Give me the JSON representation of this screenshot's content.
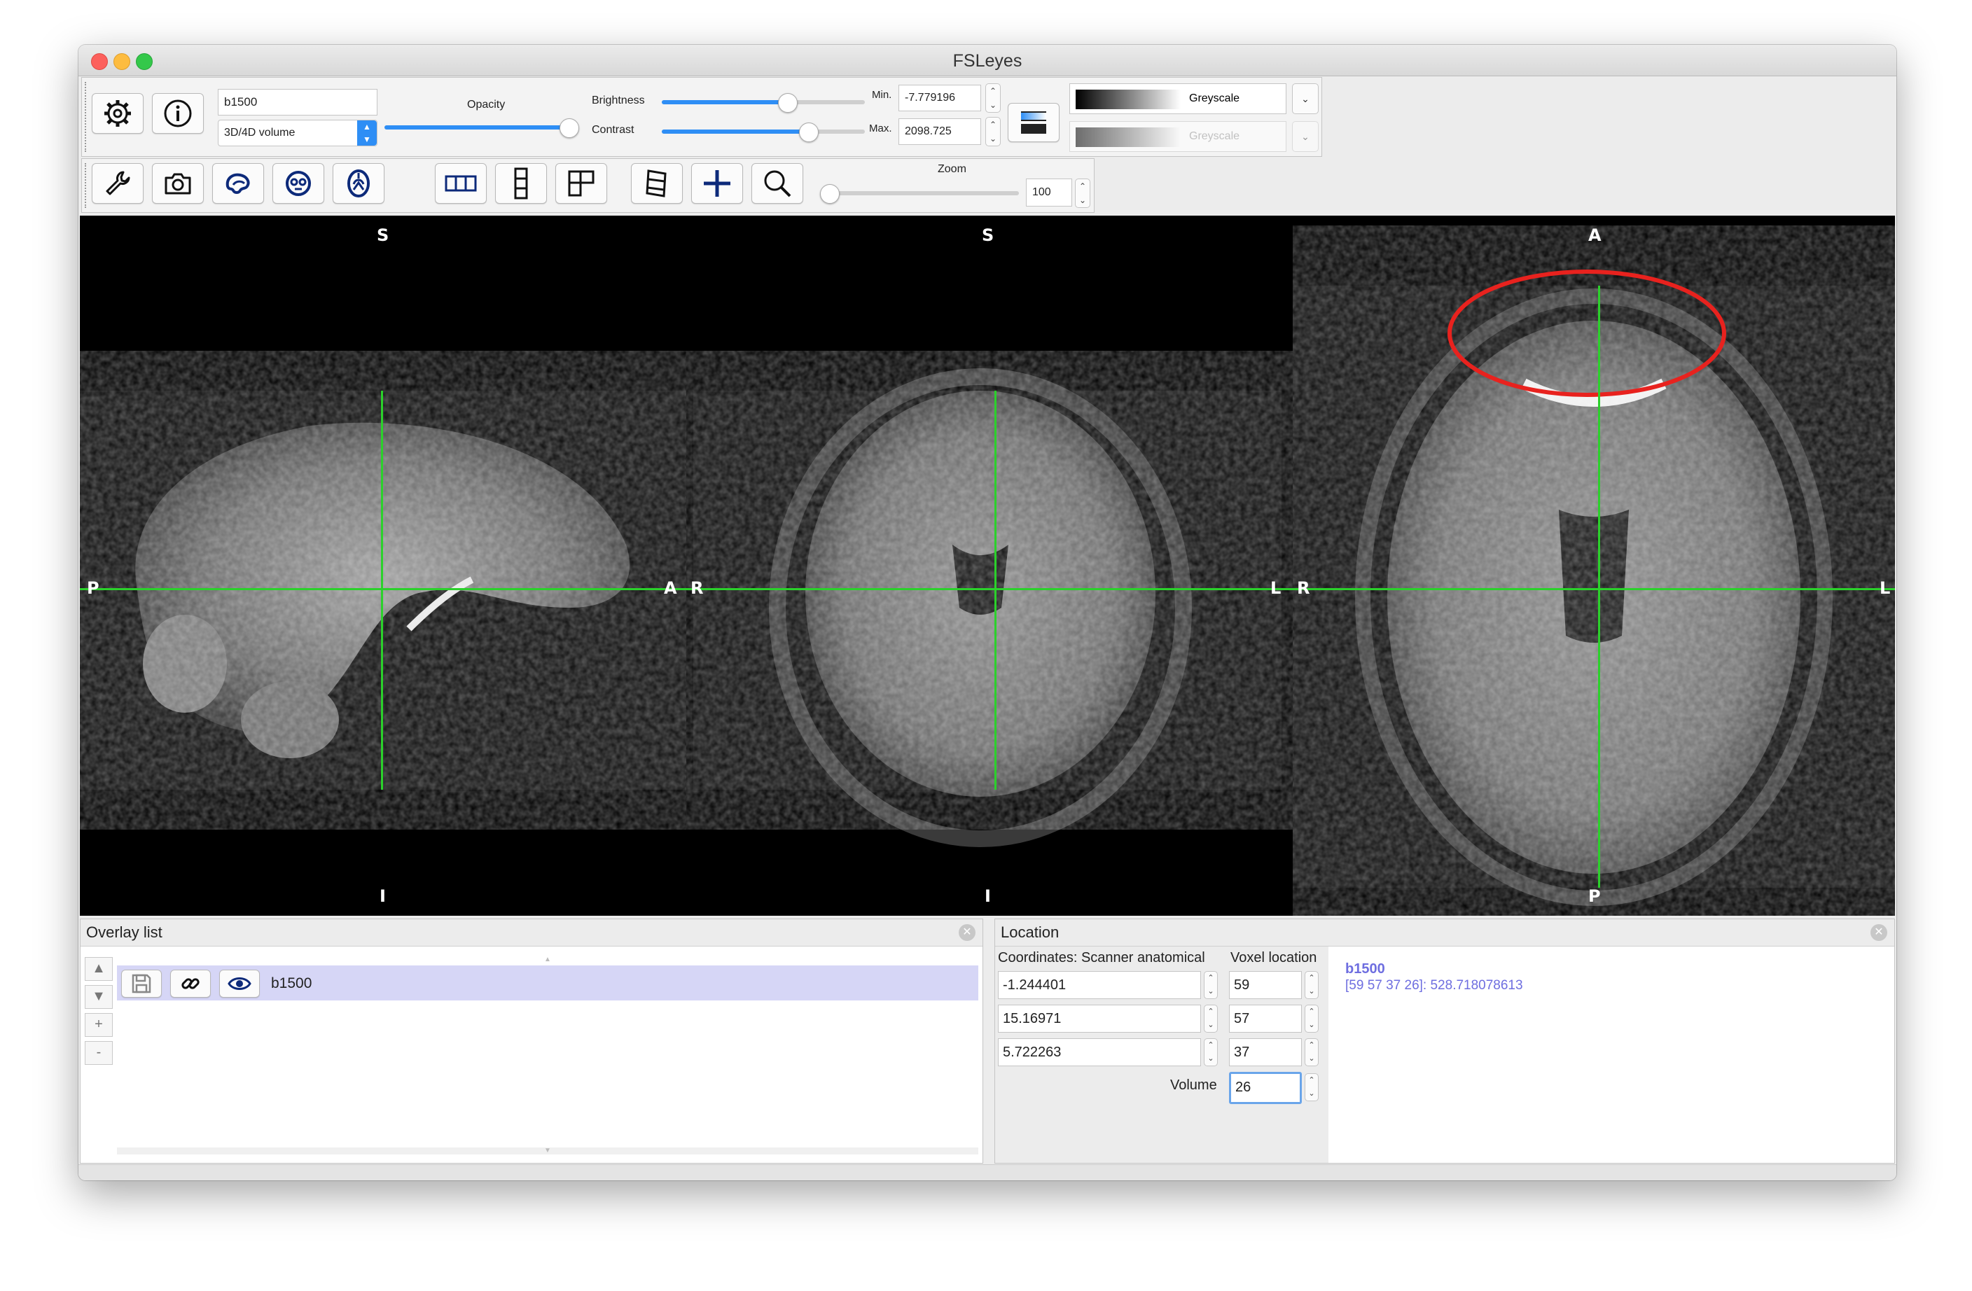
{
  "window": {
    "title": "FSLeyes"
  },
  "toolbar": {
    "overlay_name": "b1500",
    "overlay_type": "3D/4D volume",
    "opacity_label": "Opacity",
    "opacity_value": 1.0,
    "brightness_label": "Brightness",
    "brightness_value": 0.5,
    "contrast_label": "Contrast",
    "contrast_value": 0.6,
    "min_label": "Min.",
    "min_value": "-7.779196",
    "max_label": "Max.",
    "max_value": "2098.725",
    "colormap": "Greyscale",
    "neg_colormap": "Greyscale",
    "zoom_label": "Zoom",
    "zoom_value": "100"
  },
  "icons": {
    "settings": "gear-icon",
    "info": "info-icon",
    "tools": "wrench-icon",
    "screenshot": "camera-icon",
    "sagittal": "sagittal-brain-icon",
    "coronal": "coronal-brain-icon",
    "axial": "axial-brain-icon",
    "horizontal_layout": "horizontal-layout-icon",
    "vertical_layout": "vertical-layout-icon",
    "grid_layout": "grid-layout-icon",
    "movie": "film-strip-icon",
    "cursor": "crosshair-plus-icon",
    "zoom": "magnifier-icon"
  },
  "views": {
    "sagittal": {
      "top": "S",
      "bottom": "I",
      "left": "P",
      "right": "A"
    },
    "coronal": {
      "top": "S",
      "bottom": "I",
      "left": "R",
      "right": "L"
    },
    "axial": {
      "top": "A",
      "bottom": "P",
      "left": "R",
      "right": "L"
    }
  },
  "colors": {
    "cursor": "#2bd12b",
    "annotation": "#e8221e",
    "accent": "#2e8ef5",
    "selected_row": "#d6d6f6",
    "info_text": "#6e6ee0"
  },
  "overlay_list": {
    "title": "Overlay list",
    "items": [
      {
        "name": "b1500",
        "visible": true
      }
    ],
    "buttons": {
      "up": "▲",
      "down": "▼",
      "add": "+",
      "remove": "-"
    }
  },
  "location": {
    "title": "Location",
    "coord_label": "Coordinates: Scanner anatomical",
    "voxel_label": "Voxel location",
    "coords": [
      "-1.244401",
      "15.16971",
      "5.722263"
    ],
    "voxels": [
      "59",
      "57",
      "37"
    ],
    "volume_label": "Volume",
    "volume_value": "26",
    "info_name": "b1500",
    "info_value": "[59 57 37 26]: 528.718078613"
  }
}
